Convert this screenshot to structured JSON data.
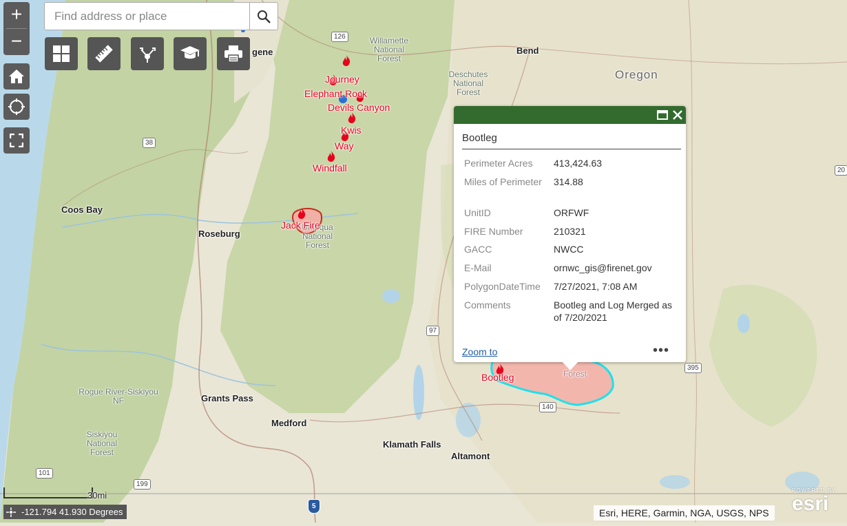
{
  "search": {
    "placeholder": "Find address or place"
  },
  "zoom": {
    "in_label": "+",
    "out_label": "−"
  },
  "tools": [
    "basemap-gallery",
    "measure",
    "share",
    "about",
    "print"
  ],
  "map_labels": {
    "eugene": "gene",
    "bend": "Bend",
    "oregon": "Oregon",
    "coos_bay": "Coos Bay",
    "roseburg": "Roseburg",
    "grants_pass": "Grants Pass",
    "medford": "Medford",
    "klamath_falls": "Klamath Falls",
    "altamont": "Altamont",
    "willamette_nf": "Willamette National Forest",
    "deschutes_nf": "Deschutes National Forest",
    "umpqua_nf": "Umpqua National Forest",
    "rogue_nf": "Rogue River-Siskiyou NF",
    "siskiyou_nf": "Siskiyou National Forest",
    "fremont_forest": "Forest"
  },
  "route_shields": [
    "126",
    "38",
    "97",
    "140",
    "395",
    "101",
    "199",
    "5",
    "20"
  ],
  "fires": [
    {
      "name": "Journey"
    },
    {
      "name": "Elephant Rock"
    },
    {
      "name": "Devils Canyon"
    },
    {
      "name": "Kwis"
    },
    {
      "name": "Way"
    },
    {
      "name": "Windfall"
    },
    {
      "name": "Jack Fire"
    },
    {
      "name": "Bootleg"
    }
  ],
  "popup": {
    "title": "Bootleg",
    "fields": [
      {
        "label": "Perimeter Acres",
        "value": "413,424.63"
      },
      {
        "label": "Miles of Perimeter",
        "value": "314.88"
      },
      {
        "label": "UnitID",
        "value": "ORFWF"
      },
      {
        "label": "FIRE Number",
        "value": "210321"
      },
      {
        "label": "GACC",
        "value": "NWCC"
      },
      {
        "label": "E-Mail",
        "value": "ornwc_gis@firenet.gov"
      },
      {
        "label": "PolygonDateTime",
        "value": "7/27/2021, 7:08 AM"
      },
      {
        "label": "Comments",
        "value": "Bootleg and Log Merged as of 7/20/2021"
      }
    ],
    "zoom_to": "Zoom to",
    "more": "•••"
  },
  "scale": {
    "label": "30mi"
  },
  "coordinates": {
    "text": "-121.794 41.930 Degrees"
  },
  "attribution": "Esri, HERE, Garmin, NGA, USGS, NPS",
  "esri_logo": {
    "powered_by": "POWERED BY",
    "logo": "esri"
  },
  "colors": {
    "map_base": "#e9e6d6",
    "forest": "#c8d6a8",
    "water": "#b3d4e8",
    "fire_label": "#e8001c",
    "perimeter": "#1fe0ea",
    "perimeter_fill": "#f2b6ad",
    "popup_header": "#336b2f",
    "toolbar": "#555555"
  }
}
